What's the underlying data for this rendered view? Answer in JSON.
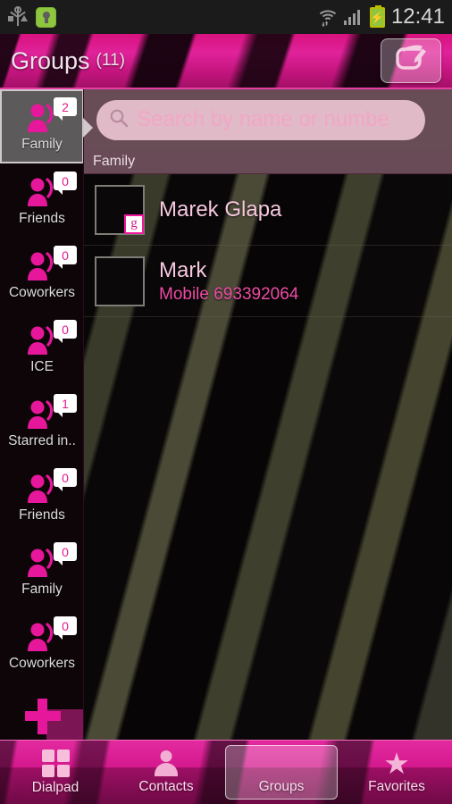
{
  "status_bar": {
    "icons": [
      "usb-icon",
      "keyguard-lock-icon",
      "wifi-icon",
      "signal-icon",
      "battery-charging-icon"
    ],
    "clock": "12:41"
  },
  "header": {
    "title": "Groups",
    "count": "(11)",
    "edit_button_icon": "edit-compose-icon"
  },
  "search": {
    "placeholder": "Search by name or numbe",
    "icon": "search-icon",
    "value": ""
  },
  "section_header": {
    "label": "Family"
  },
  "sidebar": {
    "groups": [
      {
        "label": "Family",
        "count": "2",
        "selected": true
      },
      {
        "label": "Friends",
        "count": "0",
        "selected": false
      },
      {
        "label": "Coworkers",
        "count": "0",
        "selected": false
      },
      {
        "label": "ICE",
        "count": "0",
        "selected": false
      },
      {
        "label": "Starred in..",
        "count": "1",
        "selected": false
      },
      {
        "label": "Friends",
        "count": "0",
        "selected": false
      },
      {
        "label": "Family",
        "count": "0",
        "selected": false
      },
      {
        "label": "Coworkers",
        "count": "0",
        "selected": false
      }
    ],
    "add_group_icon": "plus-icon"
  },
  "contacts": [
    {
      "name": "Marek Glapa",
      "detail": "",
      "account_badge": "g"
    },
    {
      "name": "Mark",
      "detail": "Mobile 693392064",
      "account_badge": ""
    }
  ],
  "tabbar": {
    "tabs": [
      {
        "label": "Dialpad",
        "icon": "dialpad-icon",
        "selected": false
      },
      {
        "label": "Contacts",
        "icon": "person-icon",
        "selected": false
      },
      {
        "label": "Groups",
        "icon": "groups-icon",
        "selected": true
      },
      {
        "label": "Favorites",
        "icon": "star-icon",
        "selected": false
      }
    ]
  },
  "colors": {
    "accent_pink": "#e31d8c",
    "bright_pink": "#f0189b",
    "header_pink": "#d9127e",
    "text_light": "#f0e3ea",
    "sidebar_bg": "#0d0508",
    "selected_gray": "#5d5a5c"
  }
}
